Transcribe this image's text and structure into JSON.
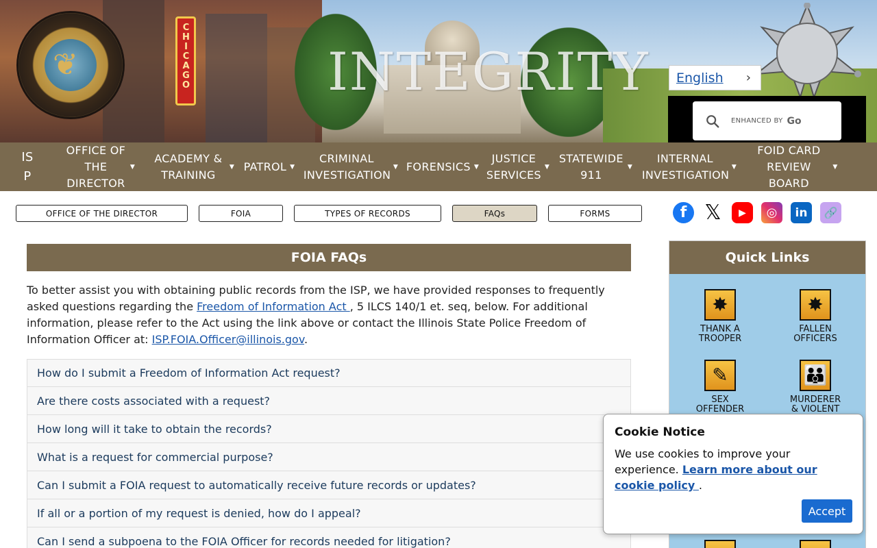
{
  "header": {
    "banner_word": "INTEGRITY",
    "sign_text": "CHICAGO",
    "language": "English",
    "search_enhanced": "ENHANCED BY",
    "search_brand": "Go"
  },
  "nav": {
    "isp": "IS P",
    "items": [
      {
        "label": "OFFICE OF THE DIRECTOR"
      },
      {
        "label": "ACADEMY & TRAINING"
      },
      {
        "label": "PATROL"
      },
      {
        "label": "CRIMINAL INVESTIGATION"
      },
      {
        "label": "FORENSICS"
      },
      {
        "label": "JUSTICE SERVICES"
      },
      {
        "label": "STATEWIDE 911"
      },
      {
        "label": "INTERNAL INVESTIGATION"
      },
      {
        "label": "FOID CARD REVIEW BOARD"
      }
    ]
  },
  "subnav": [
    {
      "label": "OFFICE OF THE DIRECTOR"
    },
    {
      "label": "FOIA"
    },
    {
      "label": "TYPES OF RECORDS"
    },
    {
      "label": "FAQs"
    },
    {
      "label": "FORMS"
    }
  ],
  "social_icons": [
    "facebook-icon",
    "x-icon",
    "youtube-icon",
    "instagram-icon",
    "linkedin-icon",
    "link-icon"
  ],
  "main": {
    "title": "FOIA FAQs",
    "intro_1": "To better assist you with obtaining public records from the ISP, we have provided responses to frequently asked questions regarding the ",
    "intro_link": "Freedom of Information Act ",
    "intro_2": ", 5 ILCS 140/1 et. seq, below. For additional information, please refer to the Act using the link above or contact the Illinois State Police Freedom of Information Officer at: ",
    "intro_email": "ISP.FOIA.Officer@illinois.gov",
    "intro_end": ".",
    "faqs": [
      "How do I submit a Freedom of Information Act request?",
      "Are there costs associated with a request?",
      "How long will it take to obtain the records?",
      "What is a request for commercial purpose?",
      "Can I submit a FOIA request to automatically receive future records or updates?",
      "If all or a portion of my request is denied, how do I appeal?",
      "Can I send a subpoena to the FOIA Officer for records needed for litigation?"
    ]
  },
  "quick_links": {
    "title": "Quick Links",
    "tiles": [
      {
        "line1": "THANK A",
        "line2": "TROOPER"
      },
      {
        "line1": "FALLEN",
        "line2": "OFFICERS"
      },
      {
        "line1": "SEX",
        "line2": "OFFENDER"
      },
      {
        "line1": "MURDERER",
        "line2": "& VIOLENT"
      }
    ]
  },
  "cookie": {
    "title": "Cookie Notice",
    "body": "We use cookies to improve your experience. ",
    "link": "Learn more about our cookie policy ",
    "end": ".",
    "accept": "Accept"
  },
  "colors": {
    "nav_bg": "#7a6a4f",
    "link": "#1a56a8",
    "quicklinks_bg": "#9fcce8",
    "accept_btn": "#1a6bd0"
  }
}
